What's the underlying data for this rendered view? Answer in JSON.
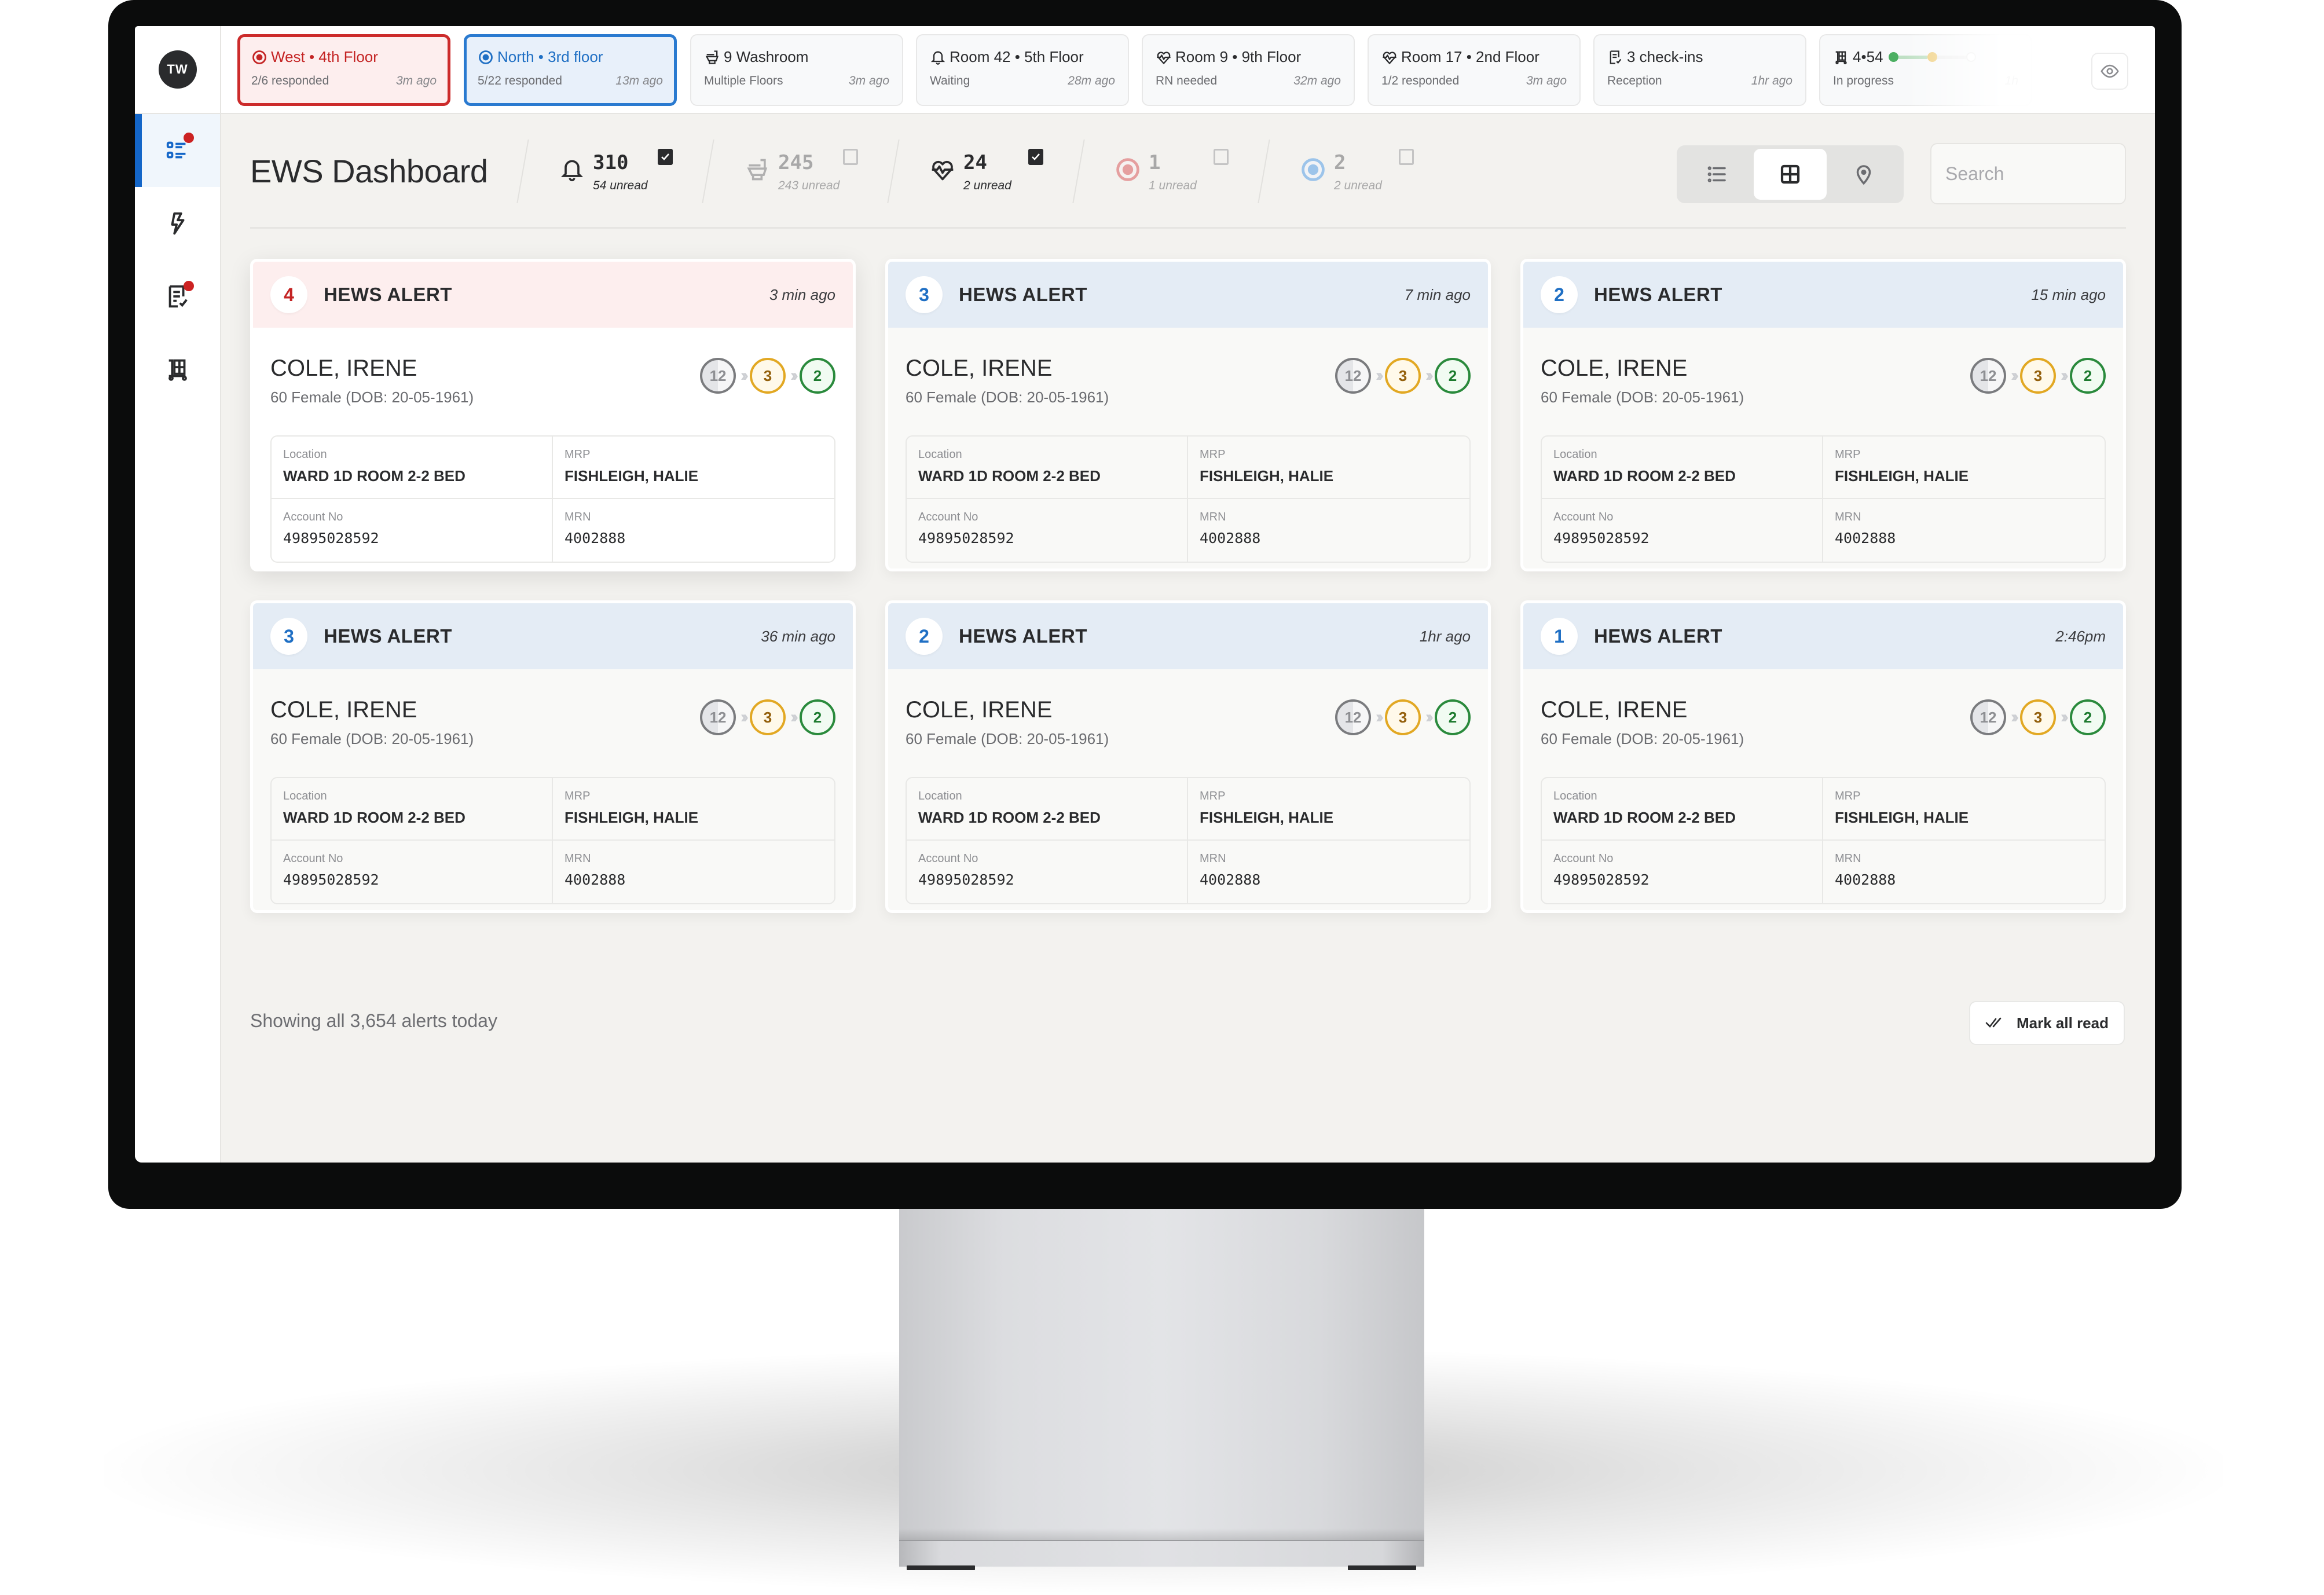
{
  "app": {
    "logo_text": "TW",
    "title": "EWS Dashboard"
  },
  "sidebar": {
    "items": [
      {
        "name": "alerts-list",
        "active": true,
        "badge": true
      },
      {
        "name": "activity",
        "active": false,
        "badge": false
      },
      {
        "name": "tasks",
        "active": false,
        "badge": true
      },
      {
        "name": "transport",
        "active": false,
        "badge": false
      }
    ]
  },
  "topbar": {
    "pills": [
      {
        "icon": "target-icon",
        "title": "West • 4th Floor",
        "subtitle": "2/6 responded",
        "ago": "3m ago",
        "style": "red"
      },
      {
        "icon": "target-icon",
        "title": "North • 3rd floor",
        "subtitle": "5/22 responded",
        "ago": "13m ago",
        "style": "blue"
      },
      {
        "icon": "toilet-icon",
        "title": "9 Washroom",
        "subtitle": "Multiple Floors",
        "ago": "3m ago",
        "style": "plain"
      },
      {
        "icon": "bell-icon",
        "title": "Room 42 • 5th Floor",
        "subtitle": "Waiting",
        "ago": "28m ago",
        "style": "plain"
      },
      {
        "icon": "heartbeat-icon",
        "title": "Room 9 • 9th Floor",
        "subtitle": "RN needed",
        "ago": "32m ago",
        "style": "plain"
      },
      {
        "icon": "heartbeat-icon",
        "title": "Room 17 • 2nd Floor",
        "subtitle": "1/2 responded",
        "ago": "3m ago",
        "style": "plain"
      },
      {
        "icon": "checklist-icon",
        "title": "3 check-ins",
        "subtitle": "Reception",
        "ago": "1hr ago",
        "style": "plain"
      },
      {
        "icon": "trolley-icon",
        "title": "4•54",
        "subtitle": "In progress",
        "ago": "1h",
        "style": "progress",
        "progress_steps": [
          "done",
          "current",
          "pending"
        ],
        "progress_colors": {
          "done": "#4caf62",
          "current": "#f0cf7e",
          "pending": "#ffffff"
        }
      }
    ],
    "eye_button": "visibility-toggle"
  },
  "stats": [
    {
      "icon": "bell-icon",
      "count": "310",
      "unread": "54 unread",
      "checked": true
    },
    {
      "icon": "toilet-icon",
      "count": "245",
      "unread": "243 unread",
      "checked": false
    },
    {
      "icon": "heartbeat-icon",
      "count": "24",
      "unread": "2 unread",
      "checked": true
    },
    {
      "icon": "red-target-icon",
      "count": "1",
      "unread": "1 unread",
      "checked": false
    },
    {
      "icon": "blue-target-icon",
      "count": "2",
      "unread": "2 unread",
      "checked": false
    }
  ],
  "view_toggle": {
    "options": [
      "list",
      "grid",
      "map"
    ],
    "selected": "grid"
  },
  "search": {
    "placeholder": "Search",
    "value": ""
  },
  "alerts": [
    {
      "score": "4",
      "severity": "red",
      "title": "HEWS ALERT",
      "time": "3 min ago",
      "patient": "COLE, IRENE",
      "meta": "60 Female (DOB: 20-05-1961)",
      "trend": [
        "12",
        "3",
        "2"
      ],
      "location_label": "Location",
      "location": "WARD 1D ROOM 2-2 BED",
      "mrp_label": "MRP",
      "mrp": "FISHLEIGH, HALIE",
      "account_label": "Account No",
      "account": "49895028592",
      "mrn_label": "MRN",
      "mrn": "4002888"
    },
    {
      "score": "3",
      "severity": "blue",
      "title": "HEWS ALERT",
      "time": "7 min ago",
      "patient": "COLE, IRENE",
      "meta": "60 Female (DOB: 20-05-1961)",
      "trend": [
        "12",
        "3",
        "2"
      ],
      "location_label": "Location",
      "location": "WARD 1D ROOM 2-2 BED",
      "mrp_label": "MRP",
      "mrp": "FISHLEIGH, HALIE",
      "account_label": "Account No",
      "account": "49895028592",
      "mrn_label": "MRN",
      "mrn": "4002888"
    },
    {
      "score": "2",
      "severity": "blue",
      "title": "HEWS ALERT",
      "time": "15 min ago",
      "patient": "COLE, IRENE",
      "meta": "60 Female (DOB: 20-05-1961)",
      "trend": [
        "12",
        "3",
        "2"
      ],
      "location_label": "Location",
      "location": "WARD 1D ROOM 2-2 BED",
      "mrp_label": "MRP",
      "mrp": "FISHLEIGH, HALIE",
      "account_label": "Account No",
      "account": "49895028592",
      "mrn_label": "MRN",
      "mrn": "4002888"
    },
    {
      "score": "3",
      "severity": "blue",
      "title": "HEWS ALERT",
      "time": "36 min ago",
      "patient": "COLE, IRENE",
      "meta": "60 Female (DOB: 20-05-1961)",
      "trend": [
        "12",
        "3",
        "2"
      ],
      "location_label": "Location",
      "location": "WARD 1D ROOM 2-2 BED",
      "mrp_label": "MRP",
      "mrp": "FISHLEIGH, HALIE",
      "account_label": "Account No",
      "account": "49895028592",
      "mrn_label": "MRN",
      "mrn": "4002888"
    },
    {
      "score": "2",
      "severity": "blue",
      "title": "HEWS ALERT",
      "time": "1hr ago",
      "patient": "COLE, IRENE",
      "meta": "60 Female (DOB: 20-05-1961)",
      "trend": [
        "12",
        "3",
        "2"
      ],
      "location_label": "Location",
      "location": "WARD 1D ROOM 2-2 BED",
      "mrp_label": "MRP",
      "mrp": "FISHLEIGH, HALIE",
      "account_label": "Account No",
      "account": "49895028592",
      "mrn_label": "MRN",
      "mrn": "4002888"
    },
    {
      "score": "1",
      "severity": "blue",
      "title": "HEWS ALERT",
      "time": "2:46pm",
      "patient": "COLE, IRENE",
      "meta": "60 Female (DOB: 20-05-1961)",
      "trend": [
        "12",
        "3",
        "2"
      ],
      "location_label": "Location",
      "location": "WARD 1D ROOM 2-2 BED",
      "mrp_label": "MRP",
      "mrp": "FISHLEIGH, HALIE",
      "account_label": "Account No",
      "account": "49895028592",
      "mrn_label": "MRN",
      "mrn": "4002888"
    }
  ],
  "footer": {
    "summary": "Showing all 3,654 alerts today",
    "mark_all_read": "Mark all read"
  },
  "colors": {
    "accent_blue": "#1466c8",
    "alert_red": "#c42323",
    "badge_red": "#cc2222",
    "trend_grey": "#7a7b7e",
    "trend_amber": "#e2a823",
    "trend_green": "#2a8a3c",
    "screen_bg": "#f3f2ef"
  }
}
